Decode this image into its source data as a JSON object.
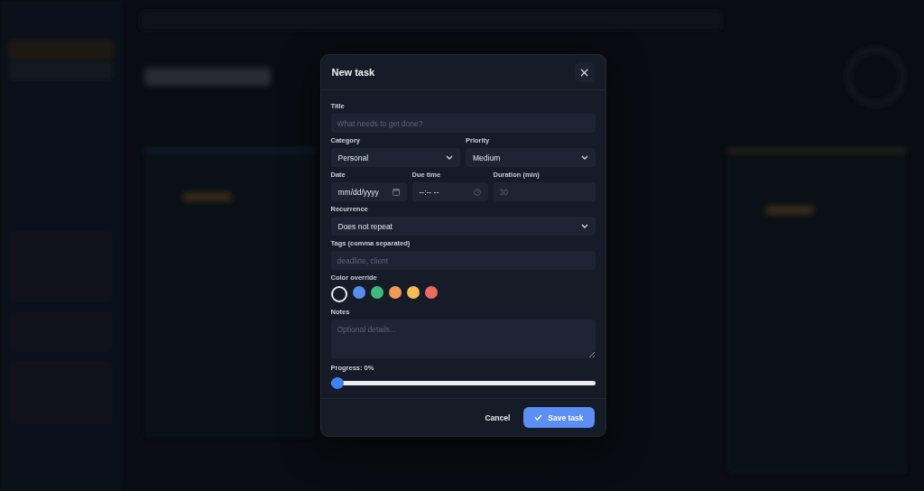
{
  "dialog": {
    "title": "New task",
    "close": "×",
    "title_field": {
      "label": "Title",
      "placeholder": "What needs to get done?"
    },
    "category": {
      "label": "Category",
      "value": "Personal"
    },
    "priority": {
      "label": "Priority",
      "value": "Medium"
    },
    "date": {
      "label": "Date",
      "value": "mm/dd/yyyy"
    },
    "due_time": {
      "label": "Due time",
      "value": "--:-- --"
    },
    "duration": {
      "label": "Duration (min)",
      "placeholder": "30"
    },
    "recurrence": {
      "label": "Recurrence",
      "value": "Does not repeat"
    },
    "tags": {
      "label": "Tags (comma separated)",
      "placeholder": "deadline, client"
    },
    "color_override": {
      "label": "Color override",
      "swatches": [
        {
          "kind": "none",
          "selected": true
        },
        {
          "kind": "color",
          "color": "#5b8def",
          "selected": false
        },
        {
          "kind": "color",
          "color": "#3dba7e",
          "selected": false
        },
        {
          "kind": "color",
          "color": "#f09a55",
          "selected": false
        },
        {
          "kind": "color",
          "color": "#f2bd55",
          "selected": false
        },
        {
          "kind": "color",
          "color": "#ec6a60",
          "selected": false
        }
      ]
    },
    "notes": {
      "label": "Notes",
      "placeholder": "Optional details..."
    },
    "progress": {
      "label": "Progress: 0%",
      "level": 0
    },
    "buttons": {
      "cancel": "Cancel",
      "save": "Save task"
    }
  }
}
